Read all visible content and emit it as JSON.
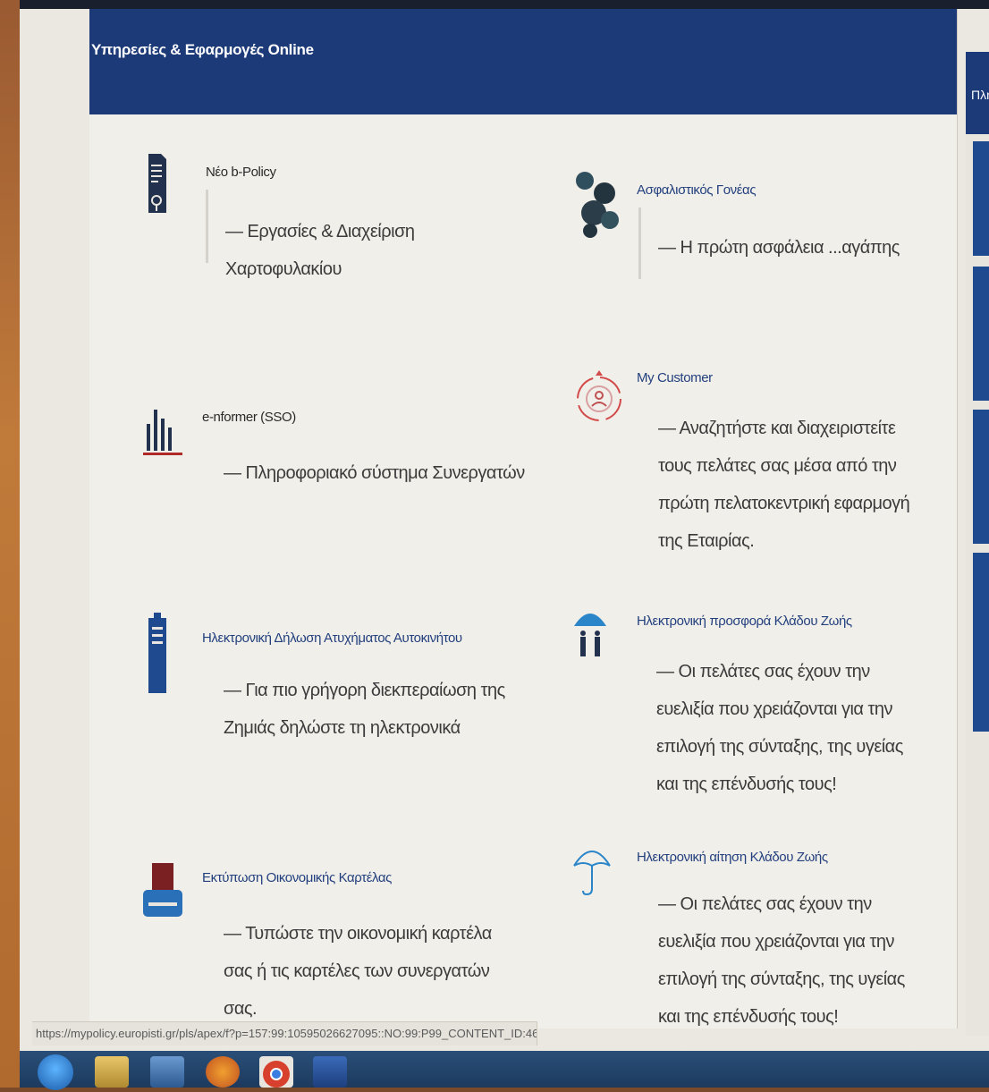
{
  "panel": {
    "title": "Υπηρεσίες & Εφαρμογές Online"
  },
  "right_panel": {
    "title": "Πλη"
  },
  "services": [
    {
      "title": "Νέο b-Policy",
      "description": "— Εργασίες & Διαχείριση Χαρτοφυλακίου",
      "icon": "document-key-icon"
    },
    {
      "title": "Ασφαλιστικός Γονέας",
      "description": "— Η πρώτη ασφάλεια ...αγάπης",
      "icon": "family-people-icon"
    },
    {
      "title": "e-nformer (SSO)",
      "description": "— Πληροφοριακό σύστημα Συνεργατών",
      "icon": "bar-chart-icon"
    },
    {
      "title": "My Customer",
      "description": "— Αναζητήστε και διαχειριστείτε τους πελάτες σας μέσα από την πρώτη πελατοκεντρική εφαρμογή της Εταιρίας.",
      "icon": "customer-cycle-icon"
    },
    {
      "title": "Ηλεκτρονική Δήλωση Ατυχήματος Αυτοκινήτου",
      "description": "— Για πιο γρήγορη διεκπεραίωση της Ζημιάς δηλώστε τη ηλεκτρονικά",
      "icon": "report-form-icon"
    },
    {
      "title": "Ηλεκτρονική προσφορά Κλάδου Ζωής",
      "description": "— Οι πελάτες σας έχουν την ευελιξία που χρειάζονται για την επιλογή της σύνταξης, της υγείας και της επένδυσής τους!",
      "icon": "umbrella-family-icon"
    },
    {
      "title": "Εκτύπωση Οικονομικής Καρτέλας",
      "description": "— Τυπώστε την οικονομική καρτέλα σας ή τις καρτέλες των συνεργατών σας.",
      "icon": "printer-icon"
    },
    {
      "title": "Ηλεκτρονική αίτηση Κλάδου Ζωής",
      "description": "— Οι πελάτες σας έχουν την ευελιξία που χρειάζονται για την επιλογή της σύνταξης, της υγείας και της επένδυσής τους!",
      "icon": "umbrella-icon"
    }
  ],
  "status_bar": {
    "url": "https://mypolicy.europisti.gr/pls/apex/f?p=157:99:10595026627095::NO:99:P99_CONTENT_ID:4645368"
  },
  "colors": {
    "header": "#1d3a78",
    "link": "#23407e",
    "icon_blue": "#1f4a90",
    "accent_red": "#b02a2a"
  }
}
